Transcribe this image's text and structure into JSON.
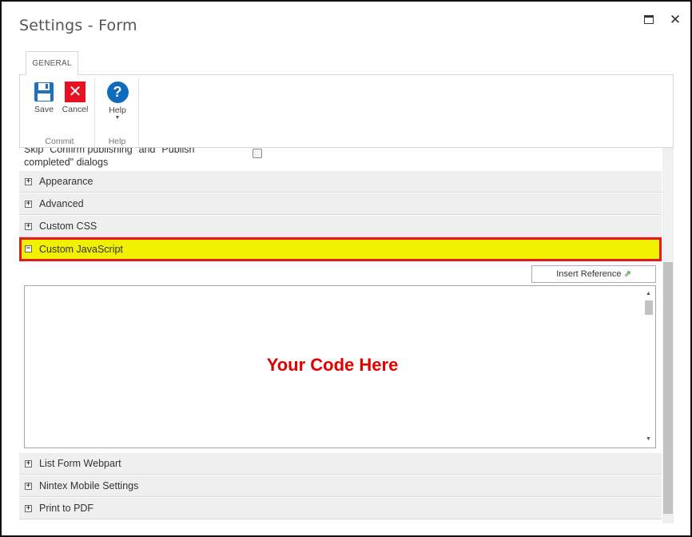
{
  "window": {
    "title": "Settings - Form",
    "maximize_icon": "maximize-icon",
    "close_glyph": "✕"
  },
  "ribbon": {
    "tab_label": "GENERAL",
    "groups": {
      "commit": {
        "label": "Commit",
        "save_label": "Save",
        "cancel_label": "Cancel"
      },
      "help": {
        "label": "Help",
        "help_label": "Help"
      }
    },
    "colors": {
      "save": "#1e73be",
      "cancel": "#e81123",
      "help": "#0f6cbd"
    }
  },
  "content": {
    "skip_option": {
      "label": "Skip \"Confirm publishing\" and \"Publish completed\" dialogs",
      "checked": false
    },
    "sections_top": [
      {
        "title": "Appearance",
        "expanded": false
      },
      {
        "title": "Advanced",
        "expanded": false
      },
      {
        "title": "Custom CSS",
        "expanded": false
      }
    ],
    "expanded_section": {
      "title": "Custom JavaScript",
      "expanded": true,
      "highlight_color": "#f0f000",
      "border_color": "#e41b1b"
    },
    "insert_reference_label": "Insert Reference",
    "editor_text": "Your Code Here",
    "editor_text_color": "#e00000",
    "sections_bottom": [
      {
        "title": "List Form Webpart",
        "expanded": false
      },
      {
        "title": "Nintex Mobile Settings",
        "expanded": false
      },
      {
        "title": "Print to PDF",
        "expanded": false
      }
    ],
    "collapsed_glyph": "+",
    "expanded_glyph": "−"
  }
}
